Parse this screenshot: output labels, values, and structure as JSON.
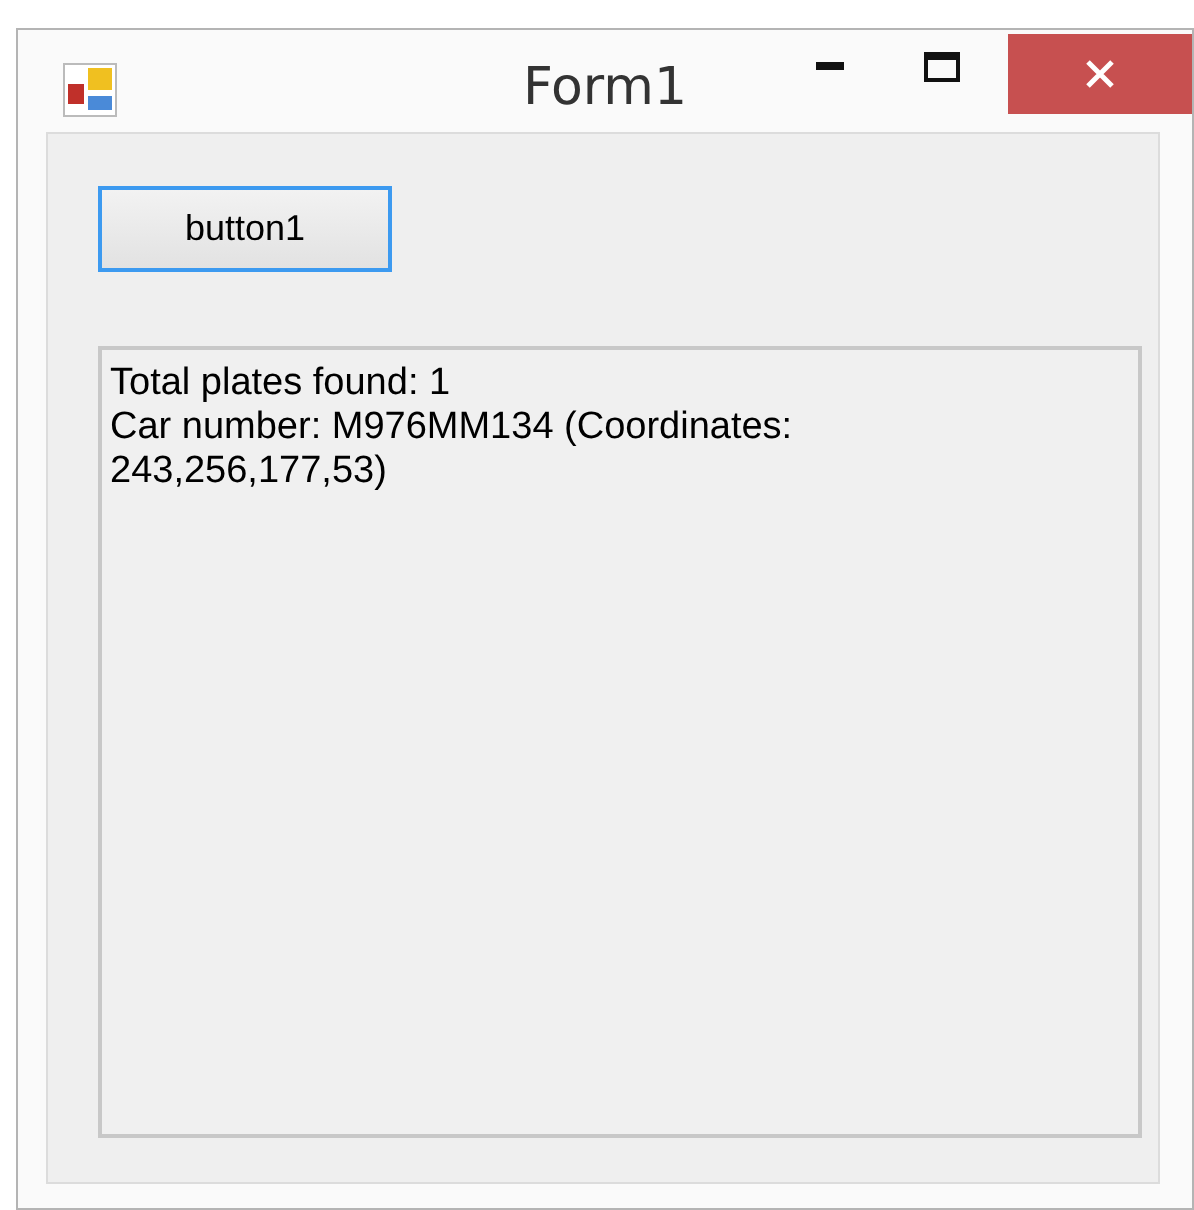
{
  "window": {
    "title": "Form1",
    "controls": [
      {
        "kind": "minimize"
      },
      {
        "kind": "maximize"
      },
      {
        "kind": "close"
      }
    ]
  },
  "button": {
    "label": "button1",
    "focused": true
  },
  "output_box": {
    "lines": [
      "Total plates found: 1",
      "Car number: M976MM134 (Coordinates:",
      "243,256,177,53)"
    ]
  }
}
